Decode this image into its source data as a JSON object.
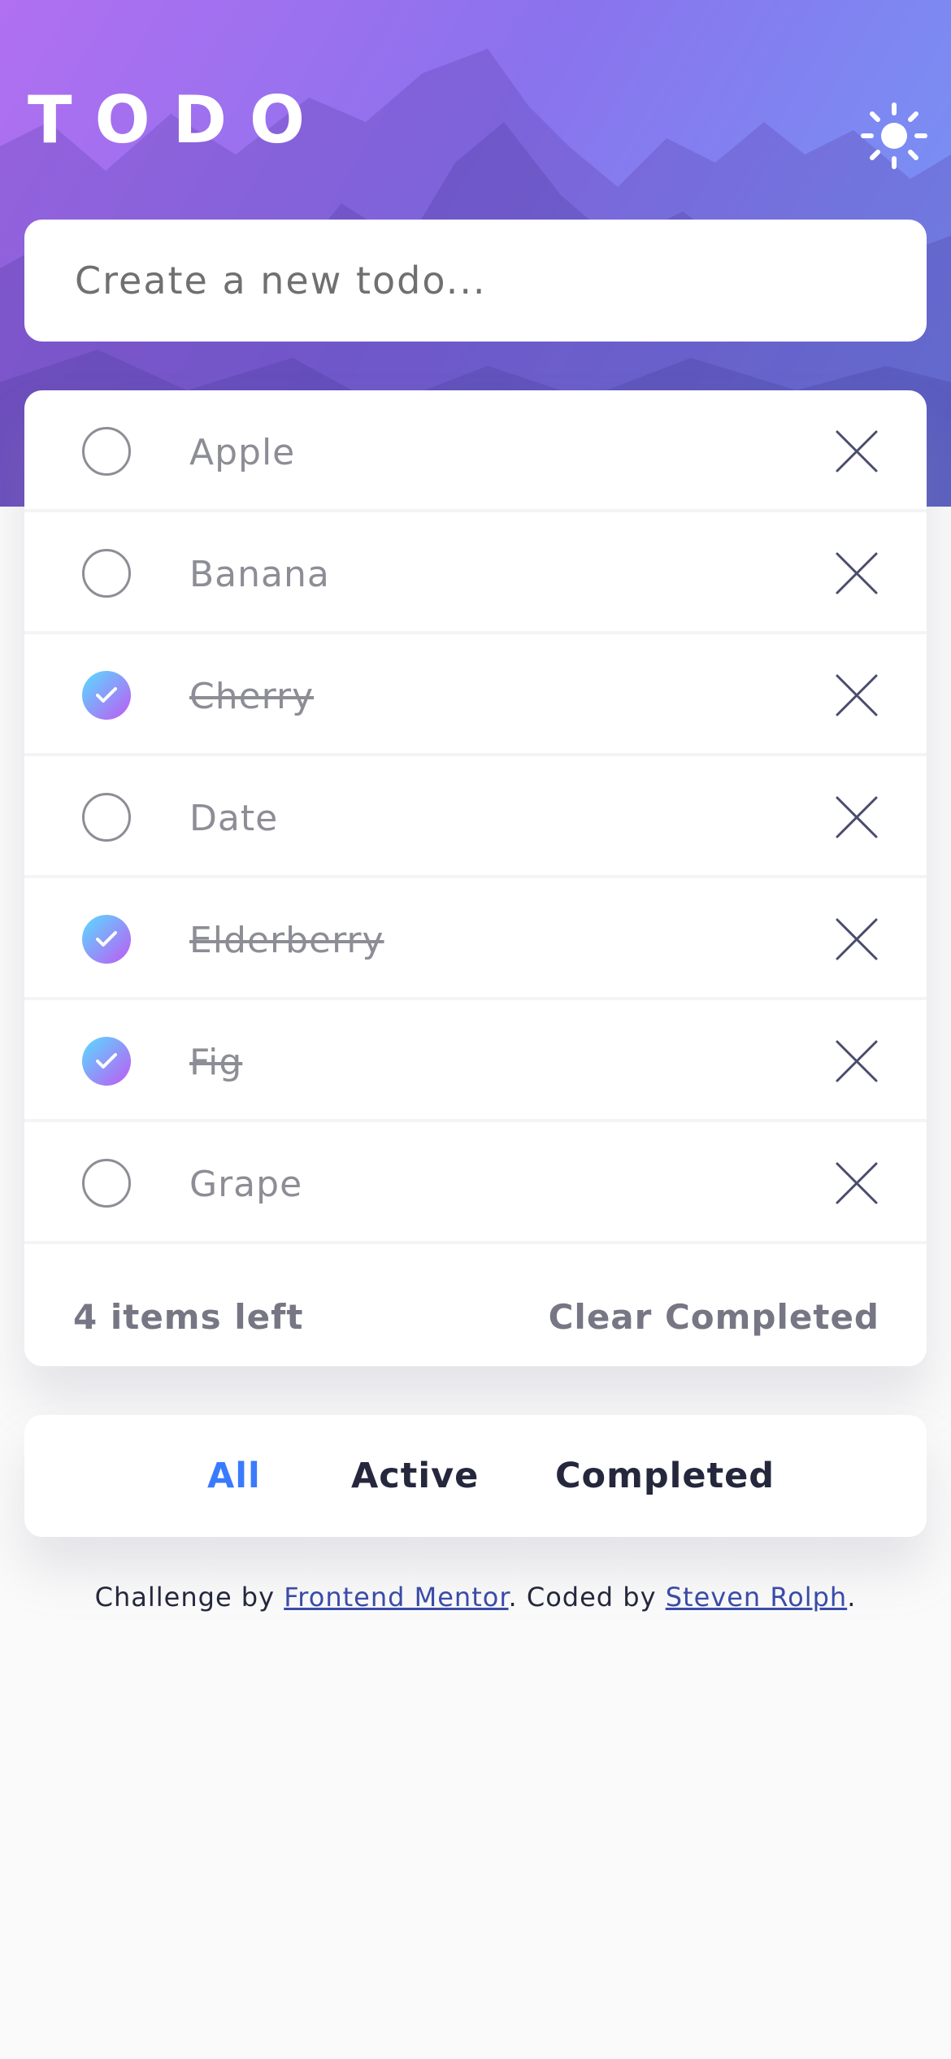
{
  "app": {
    "title": "TODO",
    "theme_toggle_icon": "sun-icon"
  },
  "new_todo": {
    "placeholder": "Create a new todo...",
    "value": ""
  },
  "todos": [
    {
      "text": "Apple",
      "completed": false
    },
    {
      "text": "Banana",
      "completed": false
    },
    {
      "text": "Cherry",
      "completed": true
    },
    {
      "text": "Date",
      "completed": false
    },
    {
      "text": "Elderberry",
      "completed": true
    },
    {
      "text": "Fig",
      "completed": true
    },
    {
      "text": "Grape",
      "completed": false
    }
  ],
  "footer": {
    "items_left": "4 items left",
    "clear_completed": "Clear Completed"
  },
  "filters": [
    {
      "label": "All",
      "active": true
    },
    {
      "label": "Active",
      "active": false
    },
    {
      "label": "Completed",
      "active": false
    }
  ],
  "attribution": {
    "prefix": "Challenge by",
    "link1": "Frontend Mentor",
    "middle": ". Coded by",
    "link2": "Steven Rolph",
    "suffix": "."
  },
  "colors": {
    "accent": "#3a7bfd",
    "check_gradient_start": "#57ddff",
    "check_gradient_end": "#c058f3",
    "background": "#fafafa"
  }
}
